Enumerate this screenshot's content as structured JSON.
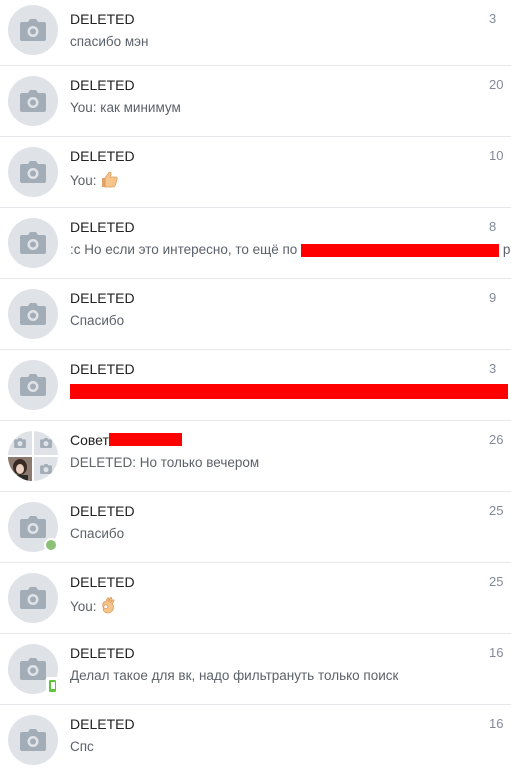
{
  "colors": {
    "avatar_bg": "#dfe3e8",
    "redaction": "#ff0000",
    "online": "#8ac176",
    "mobile": "#5ec53b",
    "separator": "#e7e8ec"
  },
  "conversations": [
    {
      "name": "DELETED",
      "snippet": "спасибо мэн",
      "time": "3"
    },
    {
      "name": "DELETED",
      "snippet": "You: как минимум",
      "time": "20"
    },
    {
      "name": "DELETED",
      "snippet": "You: ",
      "snippet_icon": "thumbs-up-emoji",
      "time": "10"
    },
    {
      "name": "DELETED",
      "snippet": ":c Но если это интересно, то ещё по",
      "time": "8",
      "snippet_tail": "р"
    },
    {
      "name": "DELETED",
      "snippet": "Спасибо",
      "time": "9"
    },
    {
      "name": "DELETED",
      "snippet": "",
      "time": "3"
    },
    {
      "name": "Совет",
      "snippet": "DELETED: Но только вечером",
      "time": "26"
    },
    {
      "name": "DELETED",
      "snippet": "Спасибо",
      "time": "25",
      "status": "online"
    },
    {
      "name": "DELETED",
      "snippet": "You: ",
      "snippet_icon": "ok-hand-emoji",
      "time": "25"
    },
    {
      "name": "DELETED",
      "snippet": "Делал такое для вк, надо фильтрануть только поиск",
      "time": "16",
      "status": "mobile"
    },
    {
      "name": "DELETED",
      "snippet": "Спс",
      "time": "16"
    }
  ]
}
